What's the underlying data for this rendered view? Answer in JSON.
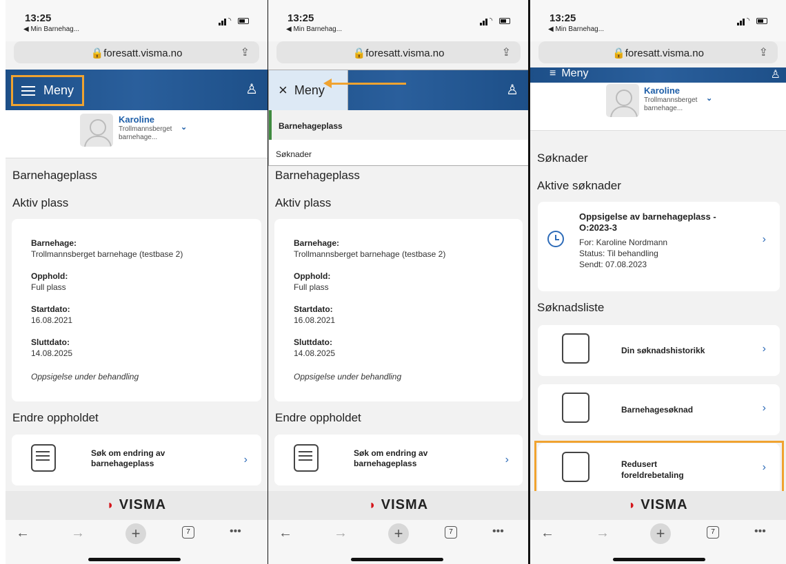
{
  "browser": {
    "time": "13:25",
    "back_app": "◀ Min Barnehag...",
    "url": "foresatt.visma.no",
    "tab_count": "7"
  },
  "header": {
    "menu_label": "Meny",
    "user_icon": "user-icon"
  },
  "profile": {
    "name": "Karoline",
    "kindergarten": "Trollmannsberget barnehage..."
  },
  "panel1": {
    "section_title": "Barnehageplass",
    "subsection": "Aktiv plass",
    "fields": [
      {
        "label": "Barnehage:",
        "value": "Trollmannsberget barnehage (testbase 2)"
      },
      {
        "label": "Opphold:",
        "value": "Full plass"
      },
      {
        "label": "Startdato:",
        "value": "16.08.2021"
      },
      {
        "label": "Sluttdato:",
        "value": "14.08.2025"
      }
    ],
    "status_note": "Oppsigelse under behandling",
    "change_title": "Endre oppholdet",
    "change_card": "Søk om endring av barnehageplass"
  },
  "panel2": {
    "menu_group": "Barnehageplass",
    "menu_item": "Søknader"
  },
  "panel3": {
    "page_title": "Søknader",
    "active_title": "Aktive søknader",
    "active_card": {
      "title": "Oppsigelse av barnehageplass - O:2023-3",
      "for": "For:  Karoline Nordmann",
      "status": "Status:  Til behandling",
      "sent": "Sendt:  07.08.2023"
    },
    "list_title": "Søknadsliste",
    "list_items": [
      "Din søknadshistorikk",
      "Barnehagesøknad",
      "Redusert foreldrebetaling"
    ]
  },
  "footer": {
    "brand": "VISMA"
  }
}
